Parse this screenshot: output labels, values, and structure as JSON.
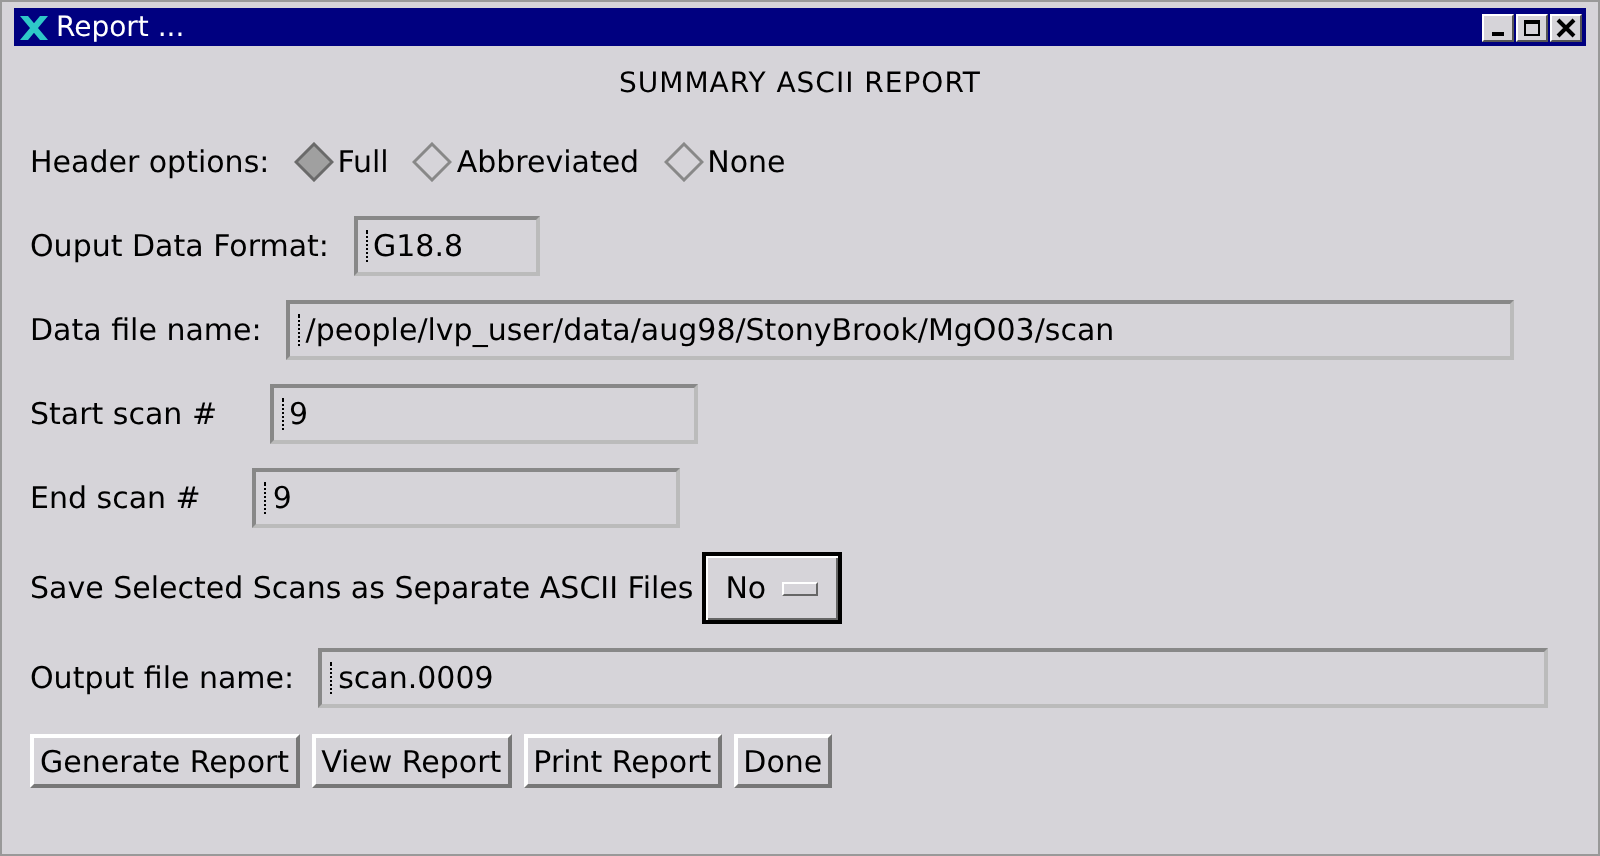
{
  "window": {
    "title": "Report ..."
  },
  "heading": "SUMMARY ASCII REPORT",
  "header_options": {
    "label": "Header options:",
    "options": [
      {
        "label": "Full",
        "selected": true
      },
      {
        "label": "Abbreviated",
        "selected": false
      },
      {
        "label": "None",
        "selected": false
      }
    ]
  },
  "fields": [
    {
      "label": "Ouput Data Format:",
      "value": "G18.8"
    },
    {
      "label": "Data file name:",
      "value": "/people/lvp_user/data/aug98/StonyBrook/MgO03/scan"
    },
    {
      "label": "Start scan #",
      "value": "9"
    },
    {
      "label": "End scan #",
      "value": "9"
    }
  ],
  "separate_files": {
    "label": "Save Selected Scans as Separate ASCII Files",
    "value": "No"
  },
  "output_file": {
    "label": "Output file name:",
    "value": "scan.0009"
  },
  "buttons": [
    "Generate Report",
    "View Report",
    "Print Report",
    "Done"
  ]
}
